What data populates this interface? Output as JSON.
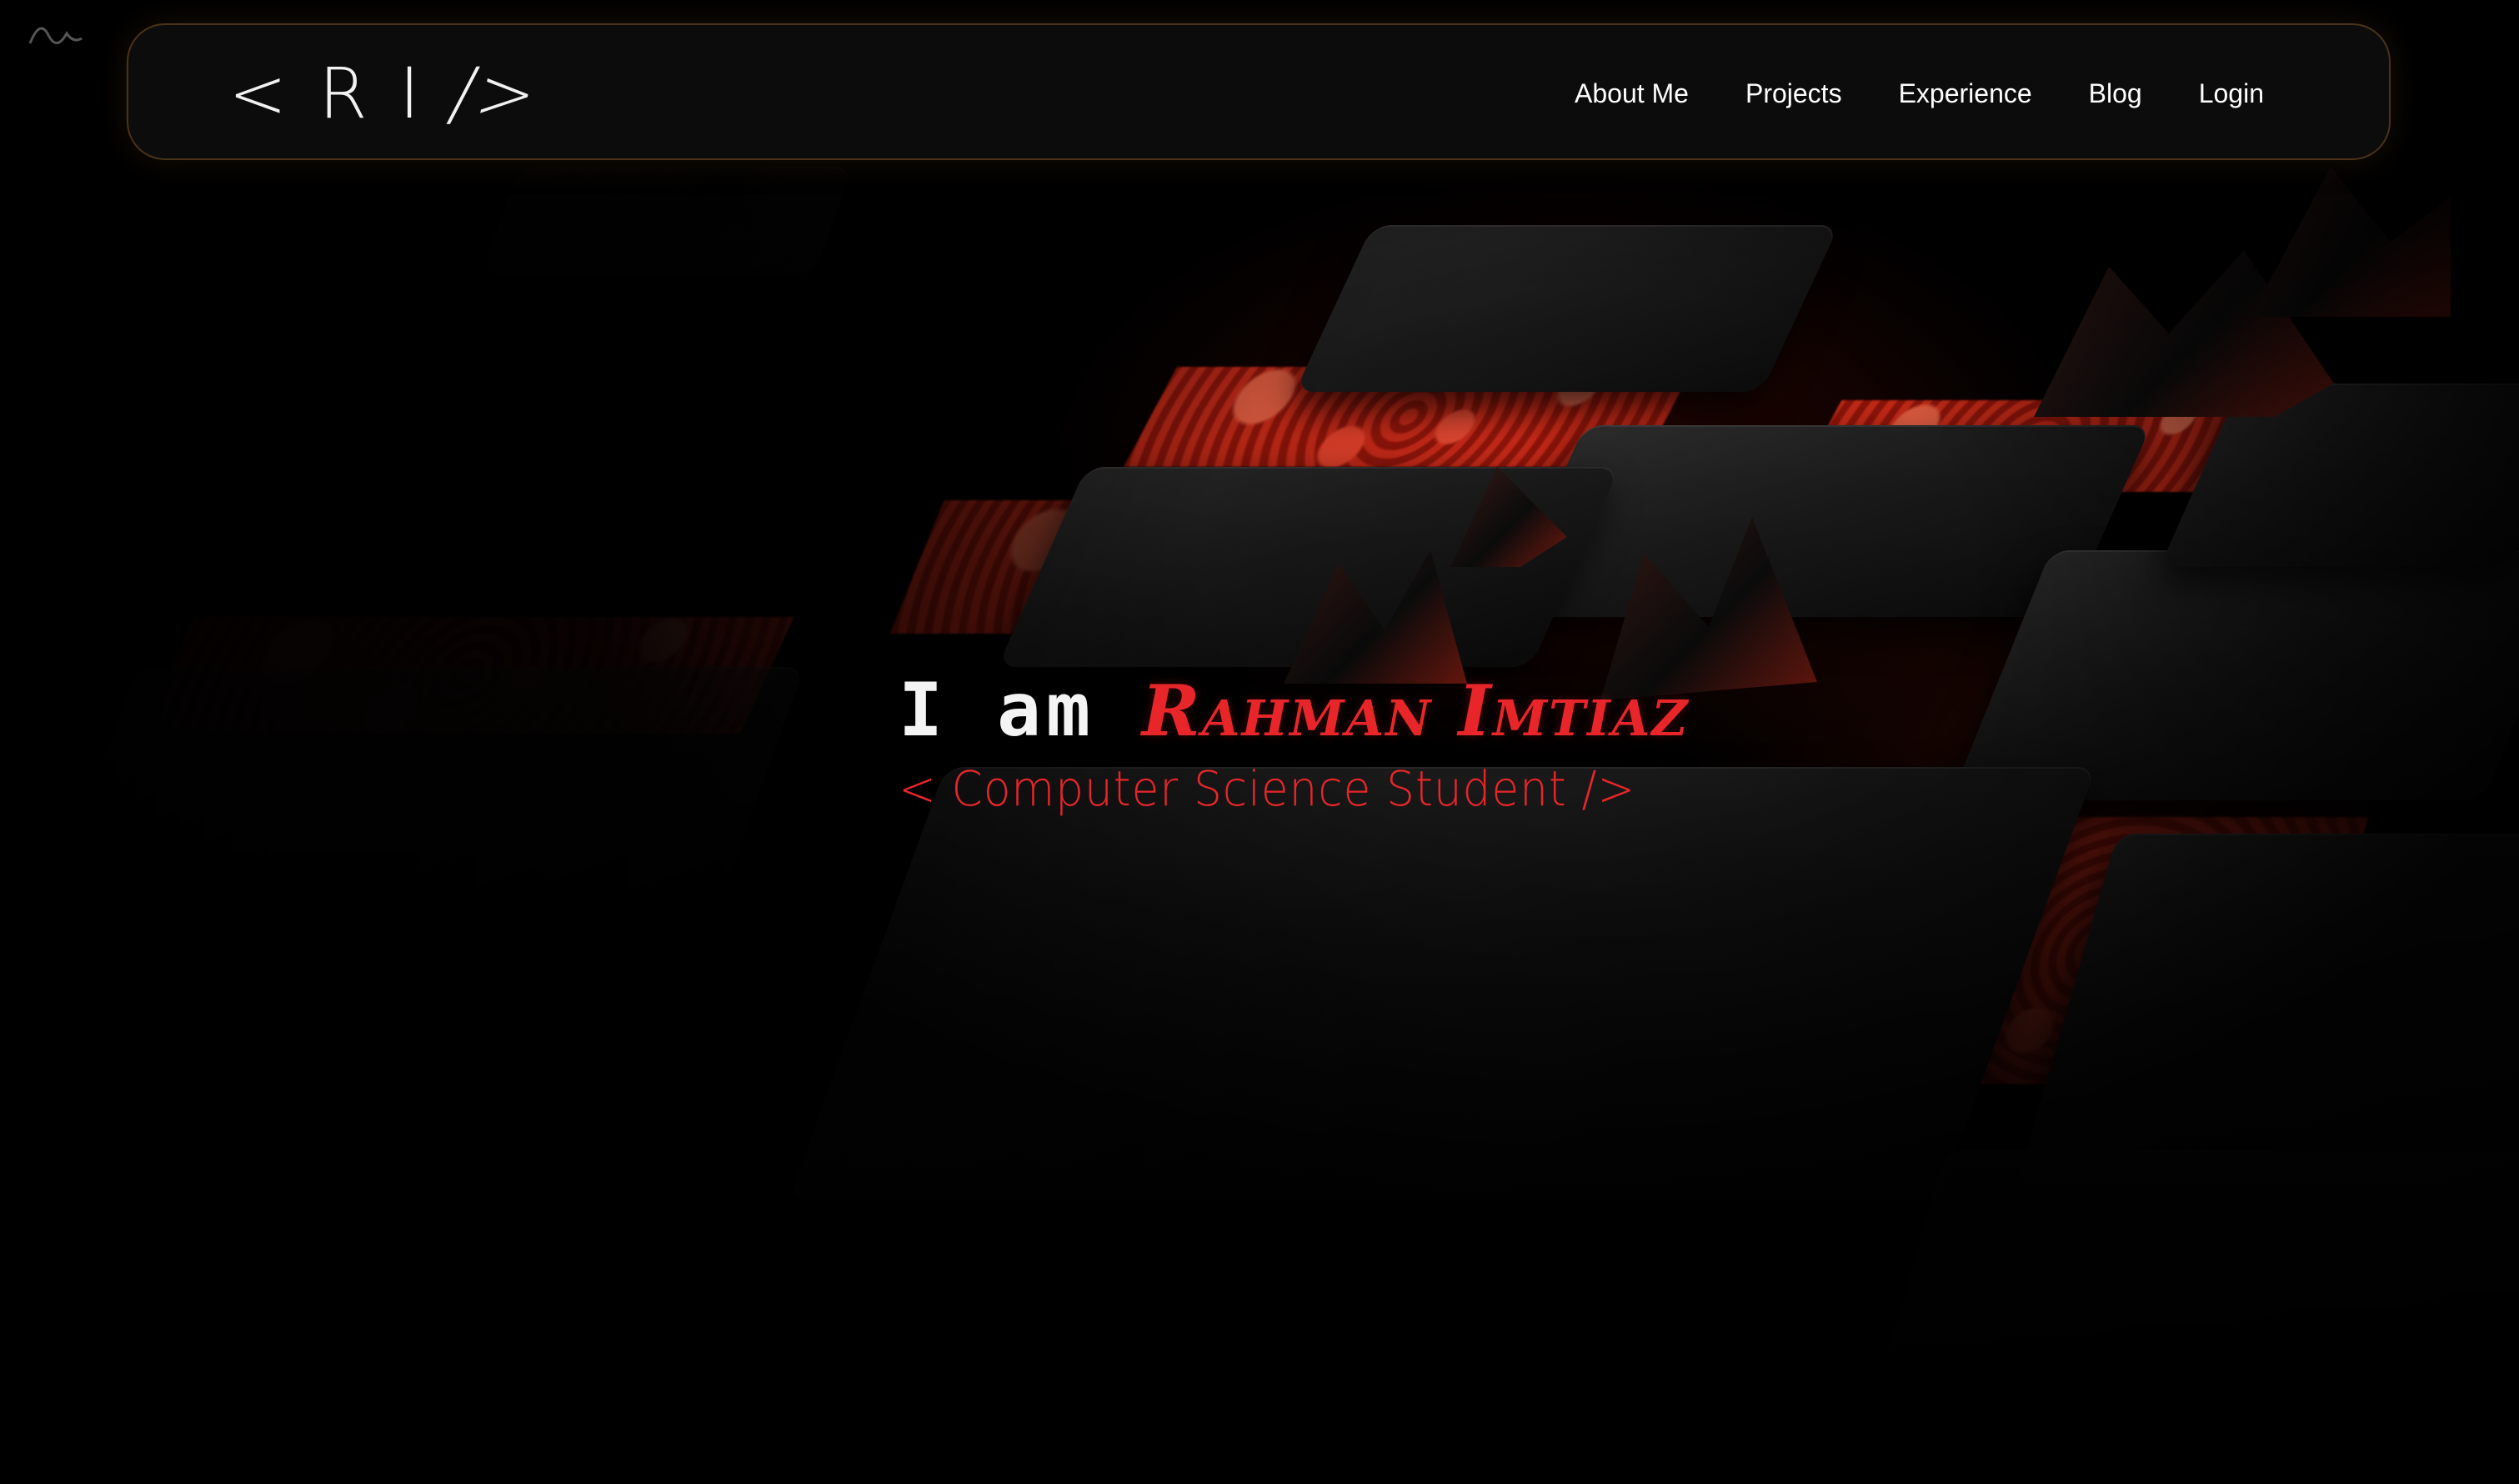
{
  "nav": {
    "logo": {
      "chars": [
        "<",
        "R",
        "I",
        "/>"
      ]
    },
    "links": [
      {
        "label": "About Me"
      },
      {
        "label": "Projects"
      },
      {
        "label": "Experience"
      },
      {
        "label": "Blog"
      },
      {
        "label": "Login"
      }
    ]
  },
  "hero": {
    "prefix": "I am",
    "name": "Rahman Imtiaz",
    "subtitle": "< Computer Science Student />"
  },
  "colors": {
    "accent": "#e8262a",
    "background": "#000000",
    "nav_background": "#0c0c0c",
    "nav_border": "#4a3318",
    "text": "#ffffff"
  },
  "icons": {
    "background_art": "lava-cube-field",
    "corner_mark": "scribble-mark"
  }
}
